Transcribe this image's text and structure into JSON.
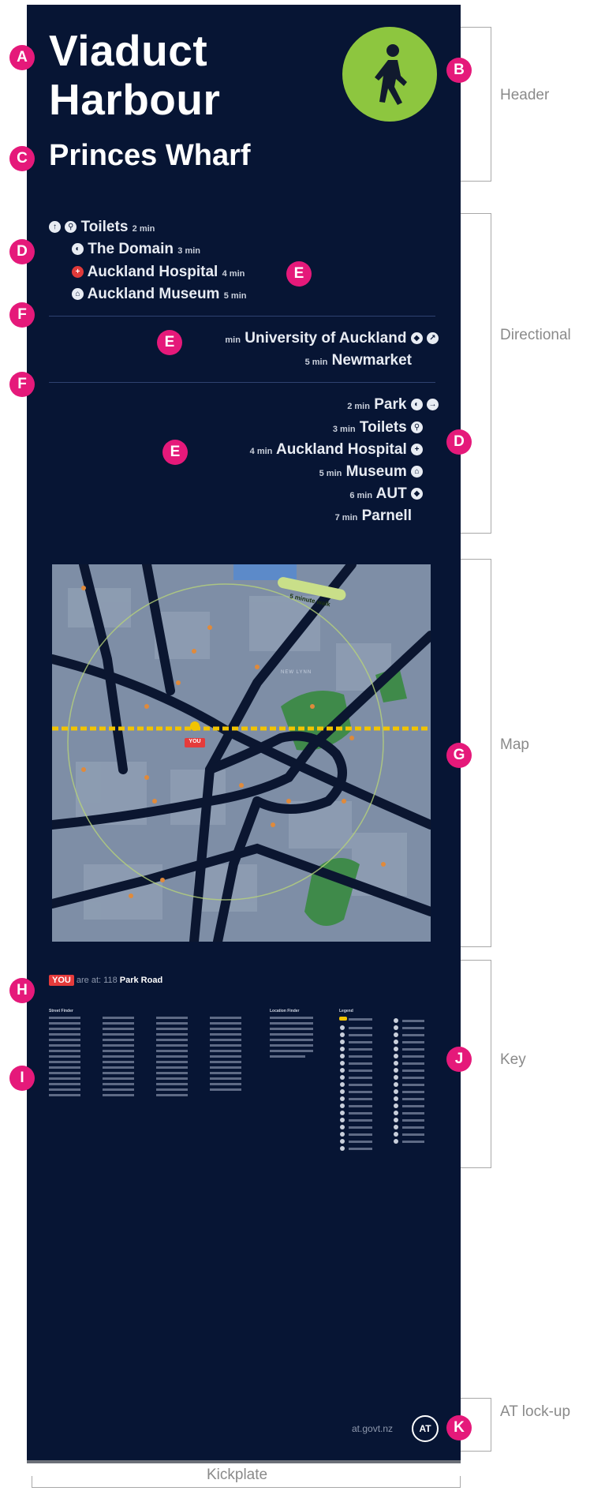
{
  "header": {
    "title_line1": "Viaduct",
    "title_line2": "Harbour",
    "subtitle": "Princes Wharf"
  },
  "badges": {
    "a": "A",
    "b": "B",
    "c": "C",
    "d": "D",
    "e": "E",
    "f": "F",
    "g": "G",
    "h": "H",
    "i": "I",
    "j": "J",
    "k": "K"
  },
  "directions": {
    "group1": [
      {
        "name": "Toilets",
        "time": "2 min"
      },
      {
        "name": "The Domain",
        "time": "3 min"
      },
      {
        "name": "Auckland Hospital",
        "time": "4 min"
      },
      {
        "name": "Auckland Museum",
        "time": "5 min"
      }
    ],
    "group2": [
      {
        "name": "University of Auckland",
        "time": "min"
      },
      {
        "name": "Newmarket",
        "time": "5 min"
      }
    ],
    "group3": [
      {
        "name": "Park",
        "time": "2 min"
      },
      {
        "name": "Toilets",
        "time": "3 min"
      },
      {
        "name": "Auckland Hospital",
        "time": "4 min"
      },
      {
        "name": "Museum",
        "time": "5 min"
      },
      {
        "name": "AUT",
        "time": "6 min"
      },
      {
        "name": "Parnell",
        "time": "7 min"
      }
    ]
  },
  "map": {
    "walk_label": "5 minute walk",
    "you_label": "YOU",
    "area_label": "NEW LYNN"
  },
  "you_are_at": {
    "you": "YOU",
    "prefix": "are at:",
    "number": "118",
    "street": "Park Road"
  },
  "key": {
    "street_finder": "Street Finder",
    "location_finder": "Location Finder",
    "legend": "Legend"
  },
  "footer": {
    "url": "at.govt.nz",
    "logo": "AT"
  },
  "annotations": {
    "header": "Header",
    "directional": "Directional",
    "map": "Map",
    "key": "Key",
    "at_lockup": "AT lock-up",
    "kickplate": "Kickplate"
  },
  "colors": {
    "sign_bg": "#071534",
    "badge": "#e5197a",
    "walk_green": "#8dc63f",
    "map_bg": "#7e8ea6",
    "road": "#0b1630",
    "park": "#3f8a4a"
  }
}
